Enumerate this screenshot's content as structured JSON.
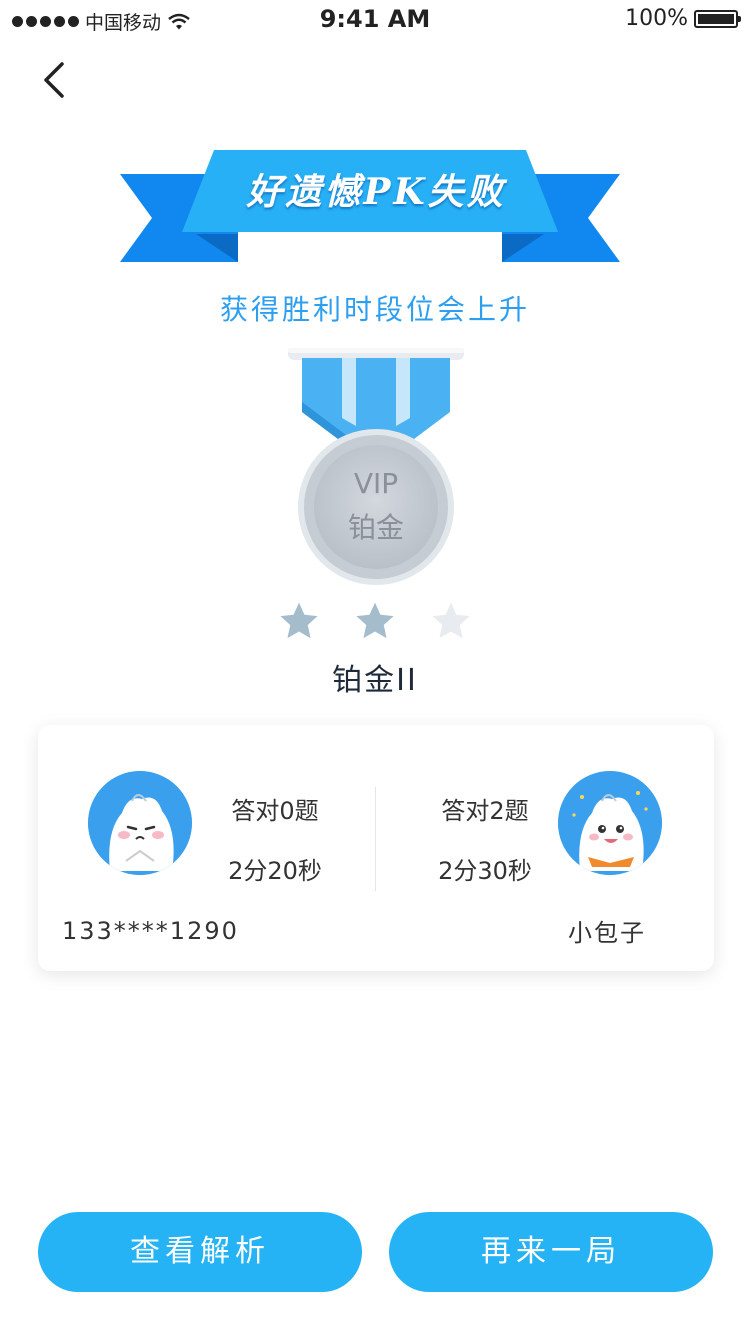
{
  "status_bar": {
    "carrier": "中国移动",
    "time": "9:41 AM",
    "battery": "100%"
  },
  "colors": {
    "ribbon_dark": "#1188f0",
    "ribbon_light": "#27b0f6",
    "accent_text": "#2d9ff0",
    "button": "#26b3f5",
    "star_filled": "#a4bccc",
    "star_empty": "#e8ecf0"
  },
  "header": {
    "back_icon": "chevron-left-icon",
    "result_title": "好遗憾PK失败",
    "subtitle": "获得胜利时段位会上升"
  },
  "medal": {
    "line1": "VIP",
    "line2": "铂金"
  },
  "rank": {
    "stars_earned": 2,
    "stars_total": 3,
    "label": "铂金II"
  },
  "result_card": {
    "left_player": {
      "avatar_icon": "dumpling-avatar-icon",
      "correct": "答对0题",
      "time": "2分20秒",
      "name": "133****1290"
    },
    "right_player": {
      "avatar_icon": "dumpling-avatar-icon",
      "correct": "答对2题",
      "time": "2分30秒",
      "name": "小包子"
    }
  },
  "actions": {
    "view_analysis": "查看解析",
    "play_again": "再来一局"
  }
}
